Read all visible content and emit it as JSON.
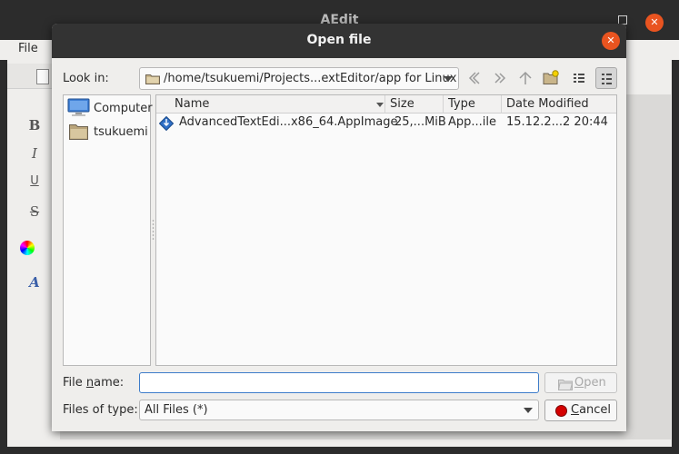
{
  "background": {
    "title": "AEdit",
    "menu_file": "File",
    "close_glyph": "✕"
  },
  "dialog": {
    "title": "Open file",
    "close_glyph": "✕",
    "look_in_label": "Look in:",
    "look_in_path": "/home/tsukuemi/Projects...extEditor/app for Linux",
    "toolbar_icons": [
      "back-icon",
      "forward-icon",
      "parent-dir-icon",
      "new-folder-icon",
      "list-view-icon",
      "detail-view-icon"
    ],
    "sidebar": [
      {
        "label": "Computer",
        "icon": "computer-icon"
      },
      {
        "label": "tsukuemi",
        "icon": "folder-icon"
      }
    ],
    "columns": [
      "Name",
      "Size",
      "Type",
      "Date Modified"
    ],
    "files": [
      {
        "name": "AdvancedTextEdi...x86_64.AppImage",
        "size": "25,...MiB",
        "type": "App...ile",
        "modified": "15.12.2...2 20:44",
        "icon": "appimage-icon"
      }
    ],
    "file_name_label": "File name:",
    "file_name_value": "",
    "files_of_type_label": "Files of type:",
    "files_of_type_value": "All Files (*)",
    "open_button": "Open",
    "cancel_button": "Cancel"
  },
  "colors": {
    "accent_close": "#e95420",
    "focus": "#3d7cc9",
    "titlebar": "#333333"
  }
}
